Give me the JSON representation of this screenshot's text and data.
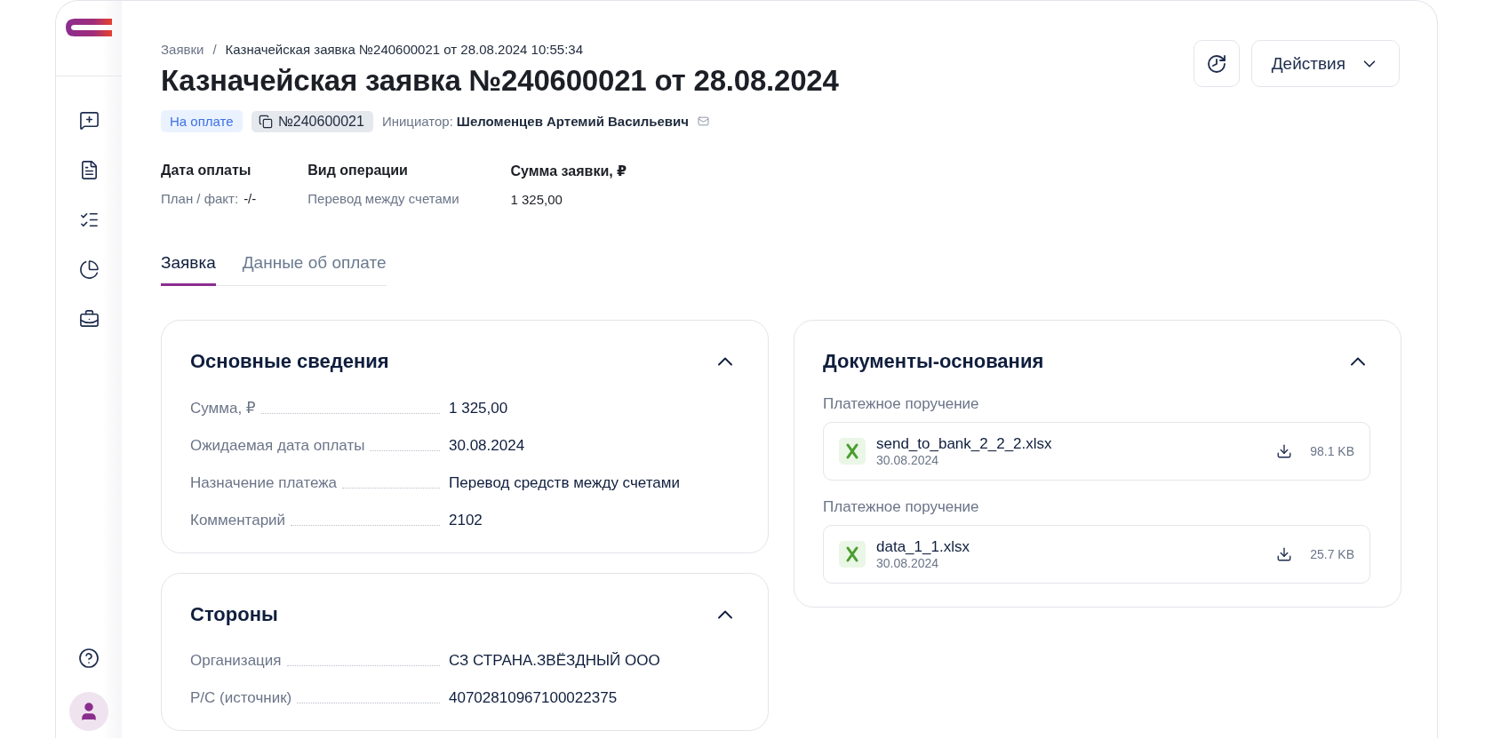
{
  "breadcrumb": {
    "items": [
      {
        "label": "Заявки"
      },
      {
        "label": "Казначейская заявка №240600021 от 28.08.2024 10:55:34"
      }
    ],
    "separator": "/"
  },
  "title": "Казначейская заявка №240600021 от 28.08.2024",
  "header_actions": {
    "actions_button": {
      "label": "Действия"
    }
  },
  "status_badge": "На оплате",
  "number_badge": "№240600021",
  "initiator": {
    "label": "Инициатор:",
    "name": "Шеломенцев Артемий Васильевич"
  },
  "summary": [
    {
      "label": "Дата оплаты",
      "prefix": "План / факт:",
      "value": "-/-",
      "muted": false
    },
    {
      "label": "Вид операции",
      "value": "Перевод между счетами",
      "muted": true
    },
    {
      "label": "Сумма заявки, ₽",
      "value": "1 325,00",
      "muted": false
    }
  ],
  "tabs": [
    {
      "label": "Заявка",
      "selected": true
    },
    {
      "label": "Данные об оплате",
      "selected": false
    }
  ],
  "left_cards": [
    {
      "title": "Основные сведения",
      "expanded": true,
      "rows": [
        {
          "label": "Сумма, ₽",
          "value": "1 325,00"
        },
        {
          "label": "Ожидаемая дата оплаты",
          "value": "30.08.2024"
        },
        {
          "label": "Назначение платежа",
          "value": "Перевод средств между счетами"
        },
        {
          "label": "Комментарий",
          "value": "2102"
        }
      ]
    },
    {
      "title": "Стороны",
      "expanded": true,
      "rows": [
        {
          "label": "Организация",
          "value": "СЗ СТРАНА.ЗВЁЗДНЫЙ ООО"
        },
        {
          "label": "Р/С (источник)",
          "value": "40702810967100022375"
        }
      ]
    }
  ],
  "right_cards": [
    {
      "title": "Документы-основания",
      "expanded": true,
      "documents": [
        {
          "type_label": "Платежное поручение",
          "file_name": "send_to_bank_2_2_2.xlsx",
          "date": "30.08.2024",
          "size": "98.1 KB"
        },
        {
          "type_label": "Платежное поручение",
          "file_name": "data_1_1.xlsx",
          "date": "30.08.2024",
          "size": "25.7 KB"
        }
      ]
    }
  ]
}
